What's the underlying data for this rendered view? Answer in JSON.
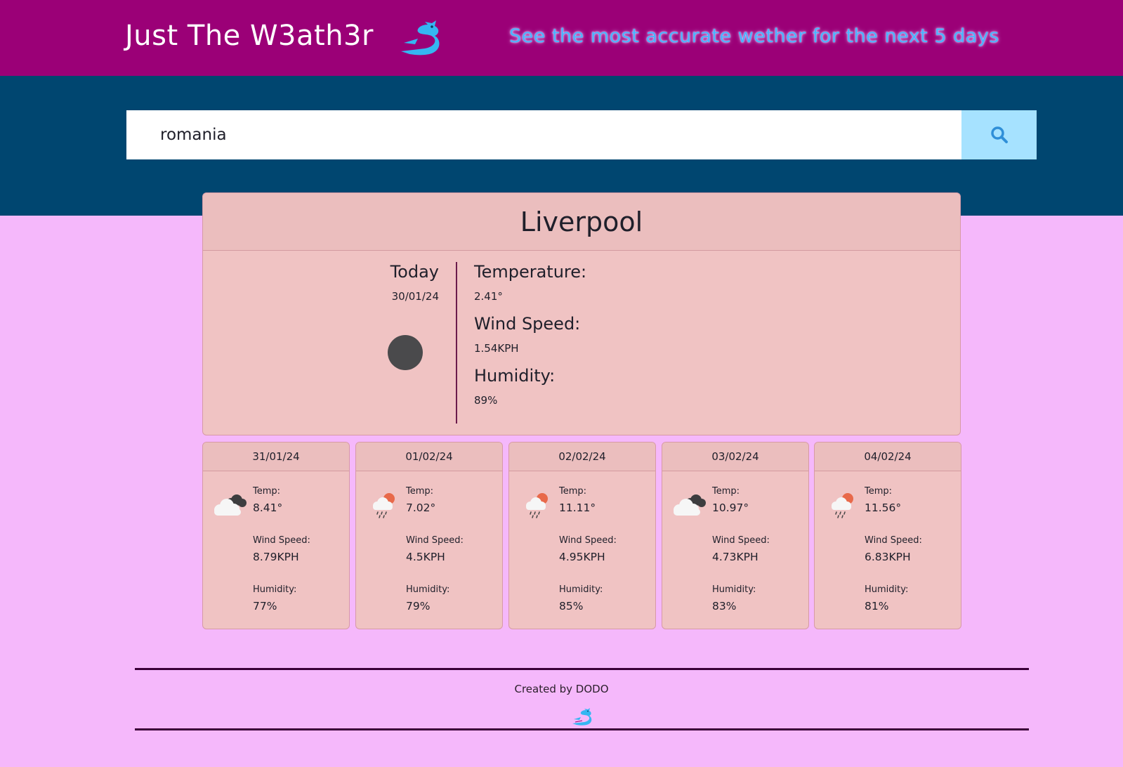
{
  "header": {
    "title": "Just The W3ath3r",
    "tagline": "See the most accurate wether for the next 5 days",
    "logo_icon": "dragon-logo-icon",
    "accent_color": "#3fb8ff"
  },
  "search": {
    "value": "romania",
    "button_icon": "search-icon"
  },
  "today": {
    "city": "Liverpool",
    "label": "Today",
    "date": "30/01/24",
    "icon": "moon-icon",
    "temperature_label": "Temperature:",
    "temperature": "2.41°",
    "wind_label": "Wind Speed:",
    "wind": "1.54KPH",
    "humidity_label": "Humidity:",
    "humidity": "89%"
  },
  "forecast": [
    {
      "date": "31/01/24",
      "icon": "cloudy-icon",
      "temp_label": "Temp:",
      "temp": "8.41°",
      "wind_label": "Wind Speed:",
      "wind": "8.79KPH",
      "humidity_label": "Humidity:",
      "humidity": "77%"
    },
    {
      "date": "01/02/24",
      "icon": "rain-sun-icon",
      "temp_label": "Temp:",
      "temp": "7.02°",
      "wind_label": "Wind Speed:",
      "wind": "4.5KPH",
      "humidity_label": "Humidity:",
      "humidity": "79%"
    },
    {
      "date": "02/02/24",
      "icon": "rain-sun-icon",
      "temp_label": "Temp:",
      "temp": "11.11°",
      "wind_label": "Wind Speed:",
      "wind": "4.95KPH",
      "humidity_label": "Humidity:",
      "humidity": "85%"
    },
    {
      "date": "03/02/24",
      "icon": "cloudy-icon",
      "temp_label": "Temp:",
      "temp": "10.97°",
      "wind_label": "Wind Speed:",
      "wind": "4.73KPH",
      "humidity_label": "Humidity:",
      "humidity": "83%"
    },
    {
      "date": "04/02/24",
      "icon": "rain-sun-icon",
      "temp_label": "Temp:",
      "temp": "11.56°",
      "wind_label": "Wind Speed:",
      "wind": "6.83KPH",
      "humidity_label": "Humidity:",
      "humidity": "81%"
    }
  ],
  "footer": {
    "credit": "Created by DODO",
    "logo_icon": "dragon-logo-icon"
  }
}
